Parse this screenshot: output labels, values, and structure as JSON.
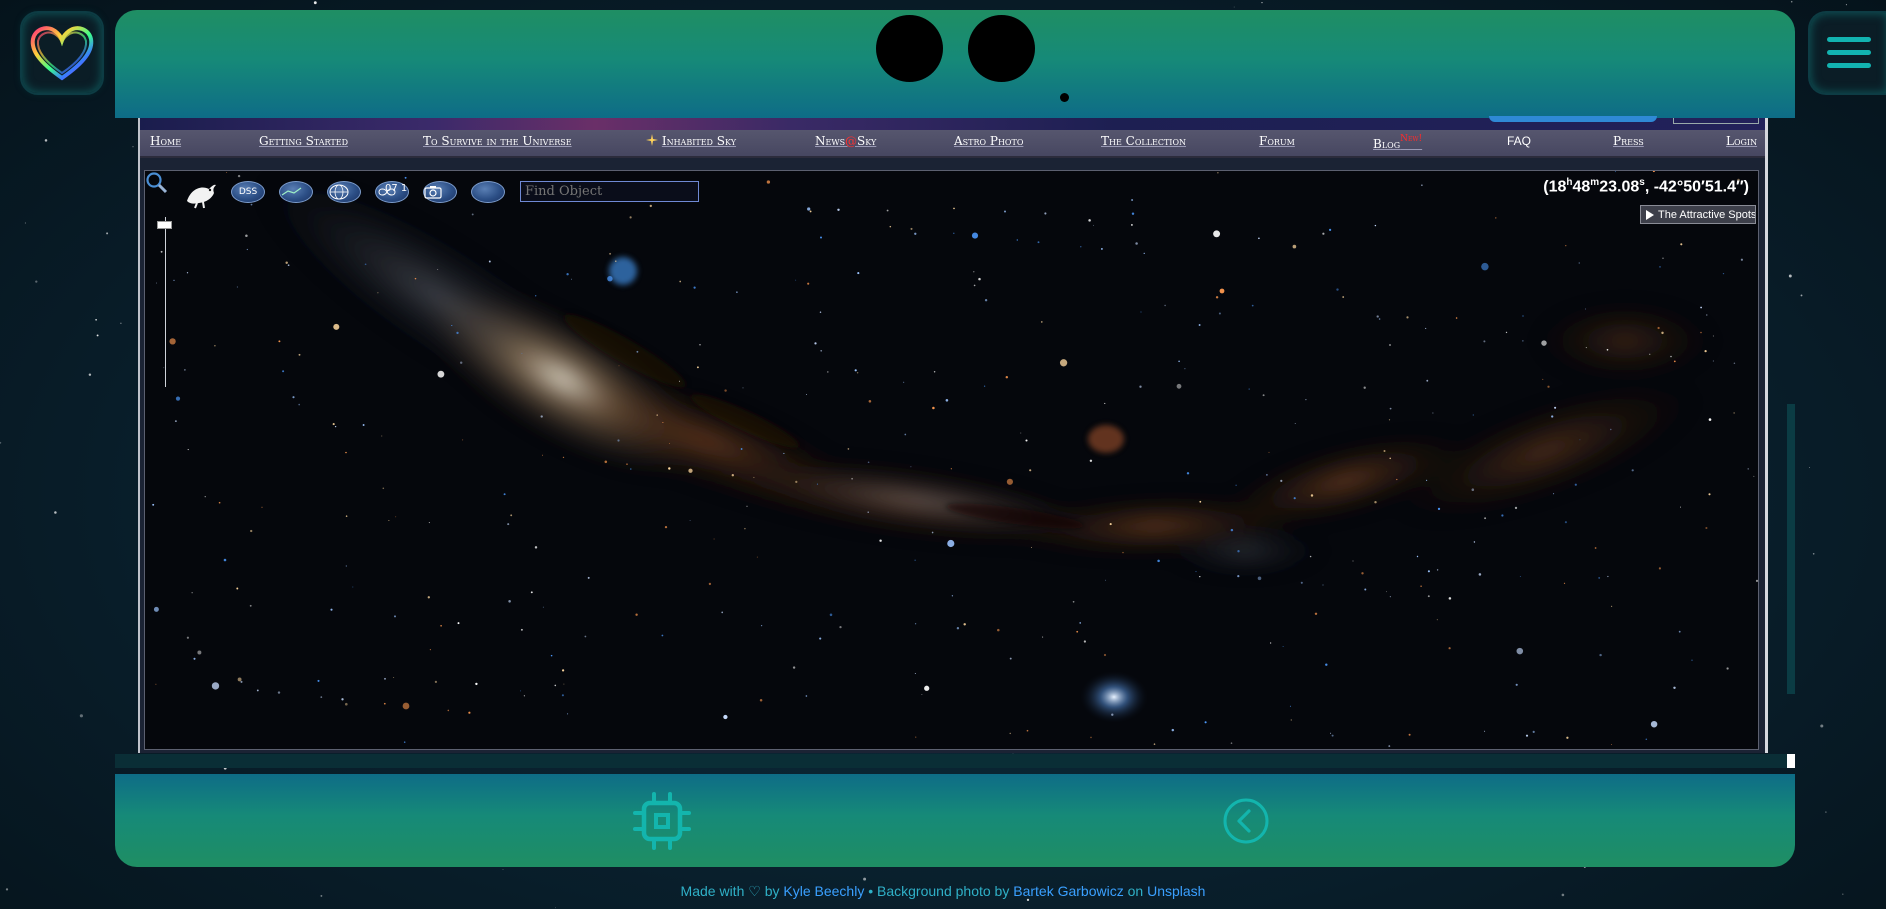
{
  "nav": {
    "home": "Home",
    "getting_started": "Getting Started",
    "survive": "To Survive in the Universe",
    "inhabited_sky": "Inhabited Sky",
    "news_prefix": "News",
    "news_at": "@",
    "news_suffix": "Sky",
    "astro_photo": "Astro Photo",
    "collection": "The Collection",
    "forum": "Forum",
    "blog": "Blog",
    "blog_badge": "New!",
    "faq": "FAQ",
    "press": "Press",
    "login": "Login"
  },
  "toolbar": {
    "dss_label": "DSS",
    "time_text": "07 1",
    "find_placeholder": "Find Object"
  },
  "coords": {
    "ra_h": "18",
    "ra_h_unit": "h",
    "ra_m": "48",
    "ra_m_unit": "m",
    "ra_s": "23.08",
    "ra_s_unit": "s",
    "dec": "-42°50′51.4″"
  },
  "attractive_spots": "The Attractive Spots",
  "footer": {
    "made_with": "Made with",
    "heart": "♡",
    "by": "by",
    "author": "Kyle Beechly",
    "sep": "•",
    "bg_photo": "Background photo by",
    "photographer": "Bartek Garbowicz",
    "on": "on",
    "site": "Unsplash"
  },
  "icons": {
    "heart": "heart-icon",
    "menu": "hamburger-menu-icon",
    "chip": "chip-icon",
    "back": "chevron-left-circle-icon",
    "search": "magnifier-icon"
  },
  "colors": {
    "panel_green": "#1f8e63",
    "panel_blue": "#0e6c87",
    "accent_teal": "#2fb0c7",
    "link_blue": "#3aa0ff"
  }
}
